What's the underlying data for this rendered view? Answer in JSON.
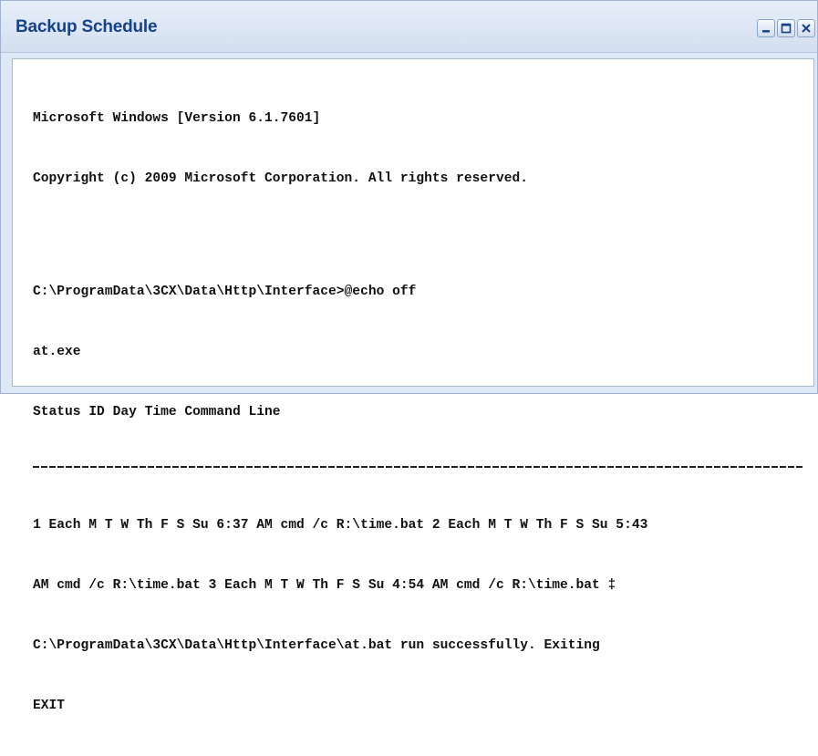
{
  "window": {
    "title": "Backup Schedule"
  },
  "controls": {
    "minimize": "minimize-icon",
    "maximize": "maximize-icon",
    "close": "close-icon"
  },
  "console": {
    "lines": [
      "Microsoft Windows [Version 6.1.7601]",
      "Copyright (c) 2009 Microsoft Corporation. All rights reserved.",
      "",
      "C:\\ProgramData\\3CX\\Data\\Http\\Interface>@echo off",
      "at.exe",
      "Status ID Day Time Command Line",
      "---",
      "1 Each M T W Th F S Su 6:37 AM cmd /c R:\\time.bat 2 Each M T W Th F S Su 5:43",
      "AM cmd /c R:\\time.bat 3 Each M T W Th F S Su 4:54 AM cmd /c R:\\time.bat ‡",
      "C:\\ProgramData\\3CX\\Data\\Http\\Interface\\at.bat run successfully. Exiting",
      "EXIT"
    ]
  },
  "colors": {
    "title_text": "#15428b",
    "titlebar_bg": "#dfe8f6",
    "border": "#9fb3cf"
  }
}
